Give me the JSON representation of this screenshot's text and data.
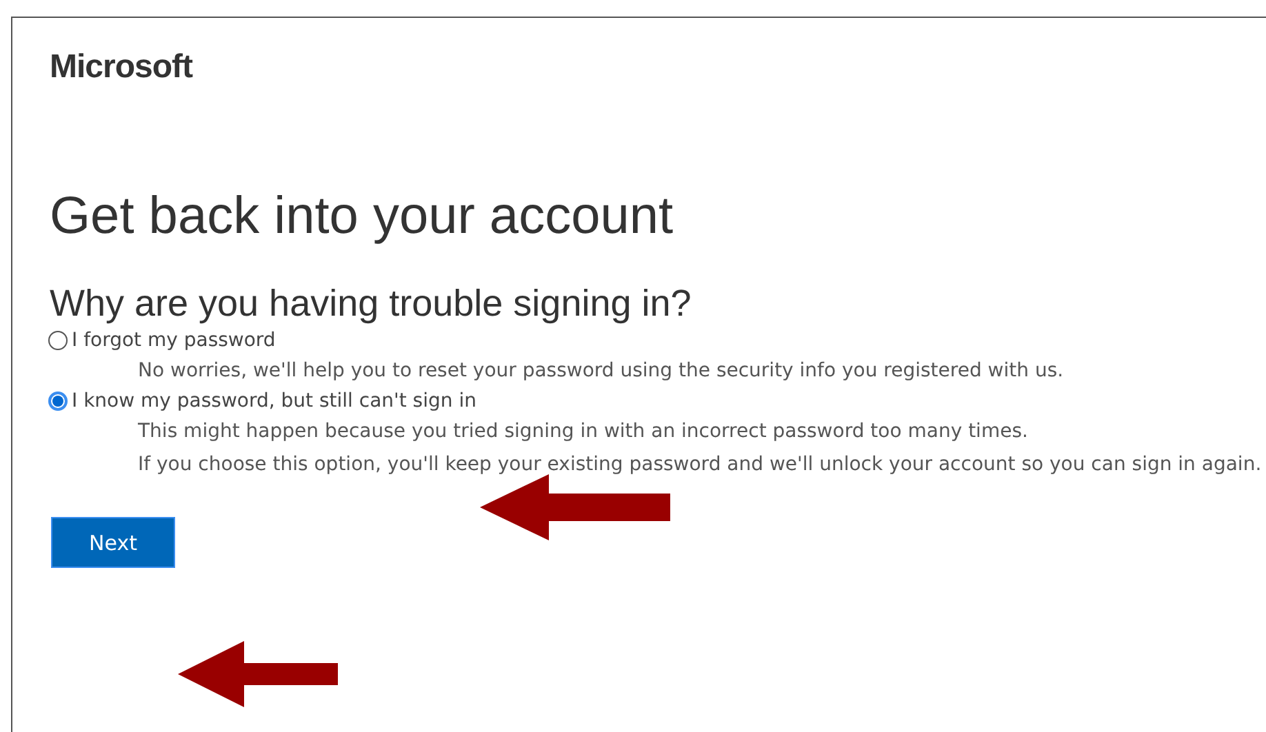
{
  "brand": "Microsoft",
  "title": "Get back into your account",
  "subtitle": "Why are you having trouble signing in?",
  "options": [
    {
      "label": "I forgot my password",
      "selected": false,
      "details": [
        "No worries, we'll help you to reset your password using the security info you registered with us."
      ]
    },
    {
      "label": "I know my password, but still can't sign in",
      "selected": true,
      "details": [
        "This might happen because you tried signing in with an incorrect password too many times.",
        "If you choose this option, you'll keep your existing password and we'll unlock your account so you can sign in again."
      ]
    }
  ],
  "button": "Next"
}
